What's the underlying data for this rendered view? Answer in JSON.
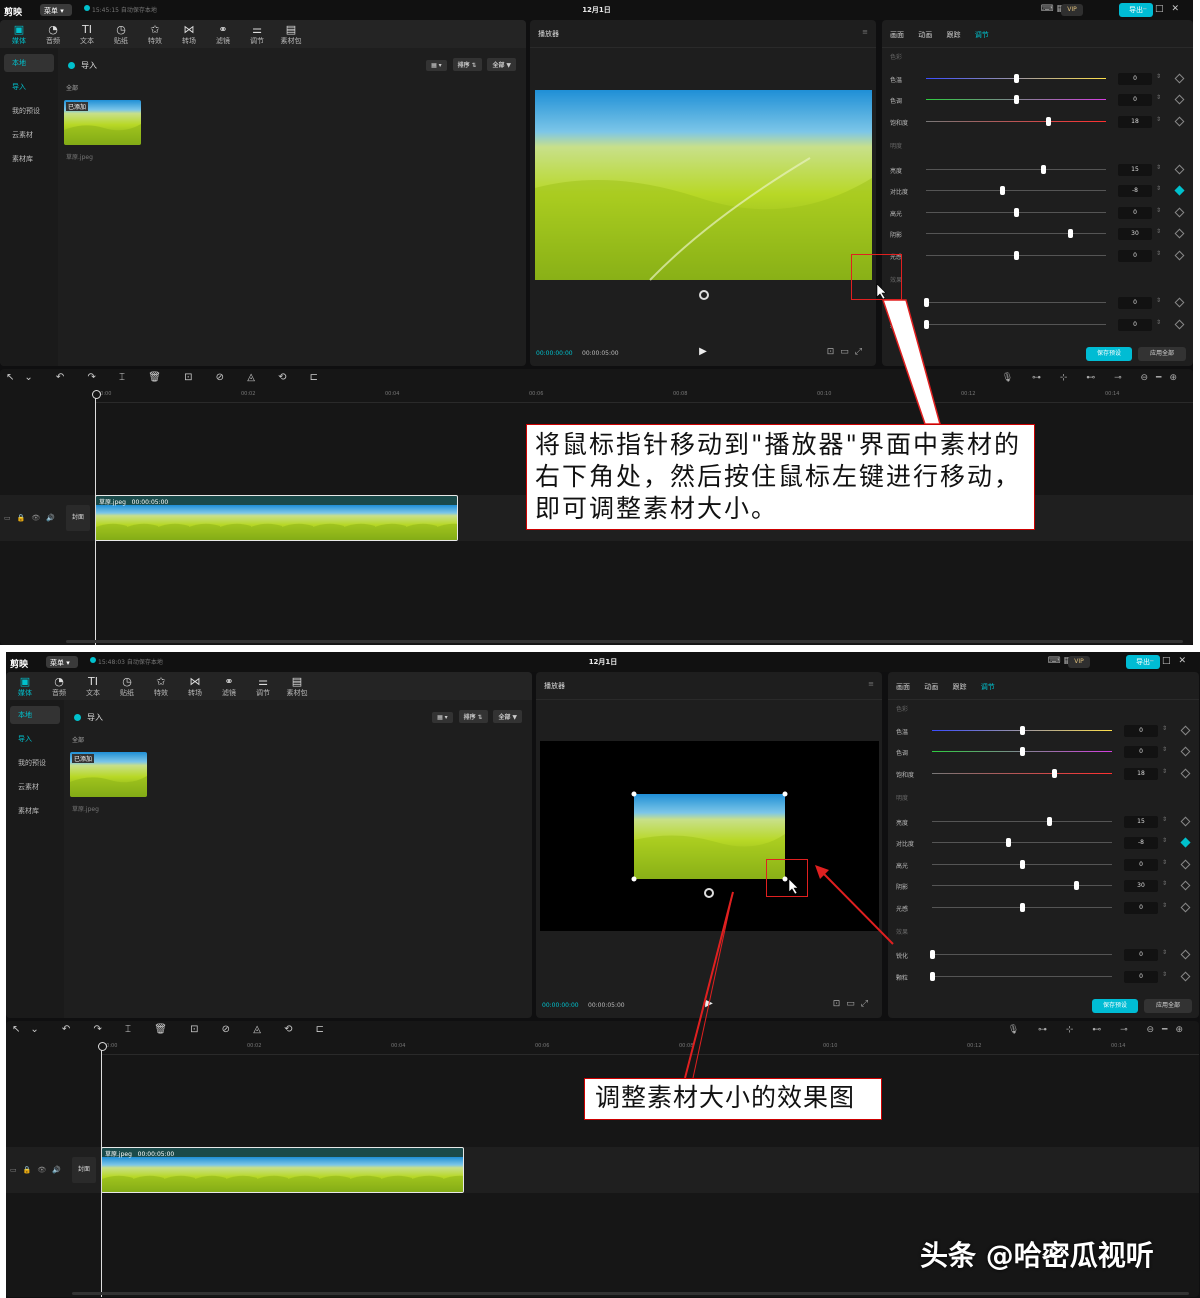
{
  "colors": {
    "accent": "#00c1cd",
    "annotation": "#e02020"
  },
  "app": {
    "logo": "剪映",
    "menu": "菜单",
    "date": "12月1日",
    "vip": "VIP",
    "export": "导出"
  },
  "shot1": {
    "save_status": "15:45:15 自动保存本地"
  },
  "shot2": {
    "save_status": "15:48:03 自动保存本地"
  },
  "toolbar": [
    "媒体",
    "音频",
    "文本",
    "贴纸",
    "特效",
    "转场",
    "滤镜",
    "调节",
    "素材包"
  ],
  "sidebar": [
    "本地",
    "导入",
    "我的预设",
    "云素材",
    "素材库"
  ],
  "media": {
    "import": "导入",
    "all": "全部",
    "sort": "排序",
    "filter": "全部",
    "added": "已添加",
    "file": "草原.jpeg"
  },
  "player": {
    "title": "播放器",
    "time_current": "00:00:00:00",
    "time_total": "00:00:05:00"
  },
  "adjust": {
    "tabs": [
      "画面",
      "动画",
      "跟踪",
      "调节"
    ],
    "sec_color": "色彩",
    "sec_light": "明度",
    "sec_effect": "效果",
    "rows": [
      {
        "label": "色温",
        "value": "0",
        "pos": 0.5
      },
      {
        "label": "色调",
        "value": "0",
        "pos": 0.5
      },
      {
        "label": "饱和度",
        "value": "18",
        "pos": 0.68
      },
      {
        "label": "亮度",
        "value": "15",
        "pos": 0.65
      },
      {
        "label": "对比度",
        "value": "-8",
        "pos": 0.42
      },
      {
        "label": "高光",
        "value": "0",
        "pos": 0.5
      },
      {
        "label": "阴影",
        "value": "30",
        "pos": 0.8
      },
      {
        "label": "光感",
        "value": "0",
        "pos": 0.5
      },
      {
        "label": "锐化",
        "value": "0",
        "pos": 0.0
      },
      {
        "label": "颗粒",
        "value": "0",
        "pos": 0.0
      }
    ],
    "save_preset": "保存预设",
    "apply_all": "应用全部"
  },
  "timeline": {
    "ruler": [
      "00:00",
      "00:02",
      "00:04",
      "00:06",
      "00:08",
      "00:10",
      "00:12",
      "00:14"
    ],
    "cover": "封面",
    "clip_name": "草原.jpeg",
    "clip_duration": "00:00:05:00"
  },
  "callout1": "将鼠标指针移动到\"播放器\"界面中素材的右下角处，然后按住鼠标左键进行移动，即可调整素材大小。",
  "callout2": "调整素材大小的效果图",
  "watermark": "头条 @哈密瓜视听"
}
